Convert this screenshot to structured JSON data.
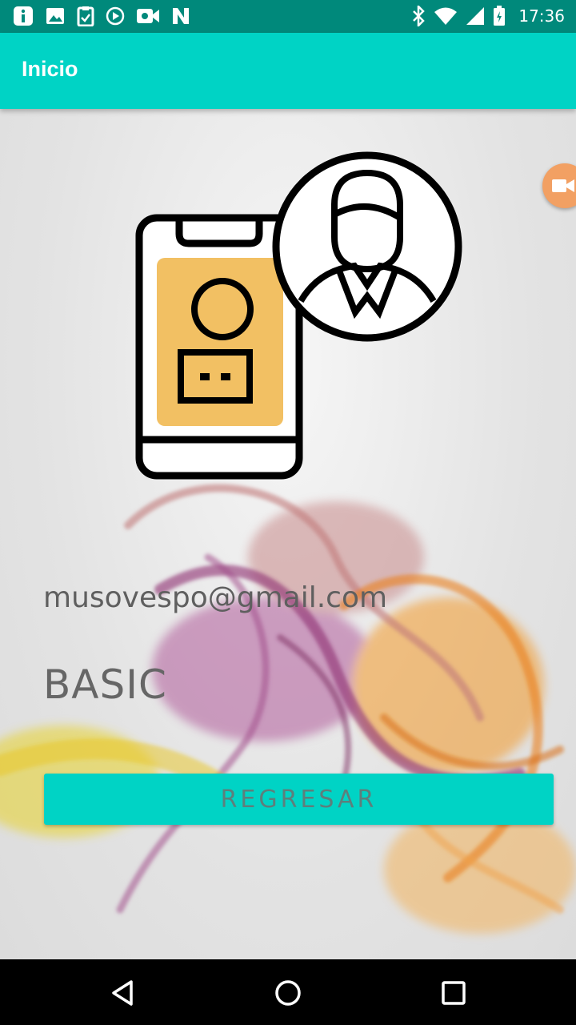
{
  "status_bar": {
    "time": "17:36",
    "left_icons": [
      "info-icon",
      "image-icon",
      "clipboard-icon",
      "play-icon",
      "video-icon",
      "n-icon"
    ],
    "right_icons": [
      "bluetooth-icon",
      "wifi-icon",
      "signal-icon",
      "battery-icon"
    ]
  },
  "app_bar": {
    "title": "Inicio"
  },
  "profile": {
    "email": "musovespo@gmail.com",
    "plan": "BASIC"
  },
  "actions": {
    "back_label": "REGRESAR"
  },
  "nav_bar": {
    "icons": [
      "back-icon",
      "home-icon",
      "recents-icon"
    ]
  },
  "colors": {
    "accent": "#00d3c5",
    "status_bar": "#00897b",
    "icon_fill": "#f2c063"
  }
}
